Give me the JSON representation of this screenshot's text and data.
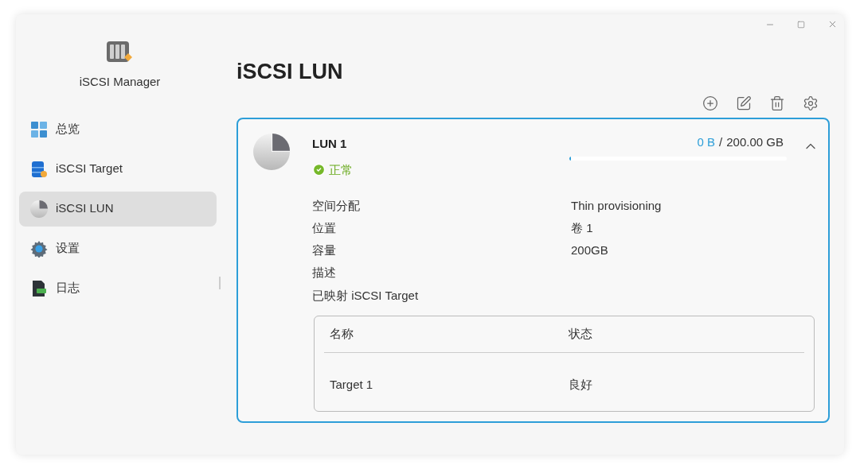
{
  "app": {
    "name": "iSCSI Manager"
  },
  "sidebar": {
    "items": [
      {
        "label": "总览",
        "selected": false
      },
      {
        "label": "iSCSI Target",
        "selected": false
      },
      {
        "label": "iSCSI LUN",
        "selected": true
      },
      {
        "label": "设置",
        "selected": false
      },
      {
        "label": "日志",
        "selected": false
      }
    ]
  },
  "page": {
    "title": "iSCSI LUN"
  },
  "lun": {
    "name": "LUN 1",
    "status": "正常",
    "used": "0 B",
    "separator": "/",
    "total": "200.00 GB",
    "level": 0.005,
    "expanded": true,
    "properties": [
      {
        "label": "空间分配",
        "value": "Thin provisioning"
      },
      {
        "label": "位置",
        "value": "卷 1"
      },
      {
        "label": "容量",
        "value": "200GB"
      },
      {
        "label": "描述"
      }
    ],
    "mapped": {
      "label": "已映射 iSCSI Target",
      "columns": [
        "名称",
        "状态"
      ],
      "rows": [
        [
          "Target 1",
          "良好"
        ]
      ]
    }
  }
}
